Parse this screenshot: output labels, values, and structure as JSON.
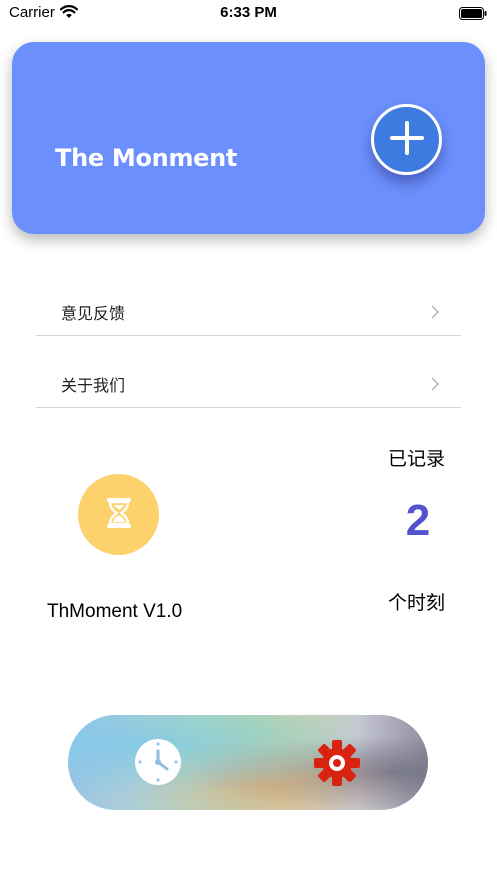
{
  "status_bar": {
    "carrier": "Carrier",
    "time": "6:33 PM",
    "wifi_icon": "wifi-icon",
    "battery_icon": "battery-icon"
  },
  "header": {
    "title": "The Monment",
    "background_color": "#6b8ffc",
    "add_button_icon": "plus-icon",
    "add_button_color": "#3e7be0"
  },
  "menu": {
    "items": [
      {
        "label": "意见反馈",
        "icon": "chevron-right-icon"
      },
      {
        "label": "关于我们",
        "icon": "chevron-right-icon"
      }
    ]
  },
  "info": {
    "logo_icon": "hourglass-icon",
    "logo_color": "#fdd16b",
    "version": "ThMoment  V1.0",
    "recorded_label": "已记录",
    "recorded_count": "2",
    "recorded_count_color": "#5552cf",
    "moments_label": "个时刻"
  },
  "tab_bar": {
    "items": [
      {
        "icon": "clock-icon"
      },
      {
        "icon": "gear-icon",
        "color": "#d9220f"
      }
    ]
  }
}
